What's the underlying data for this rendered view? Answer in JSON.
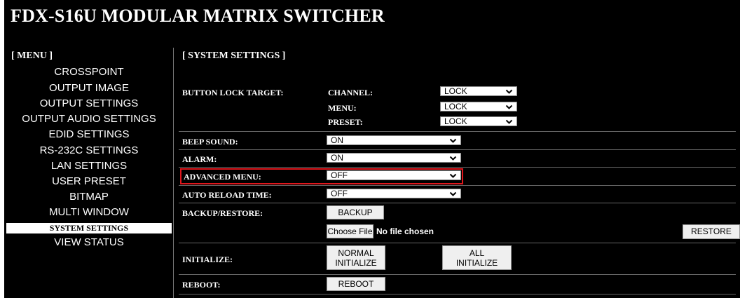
{
  "header": {
    "title": "FDX-S16U MODULAR MATRIX SWITCHER"
  },
  "menu": {
    "header": "[ MENU ]",
    "items": [
      {
        "label": "CROSSPOINT",
        "active": false
      },
      {
        "label": "OUTPUT IMAGE",
        "active": false
      },
      {
        "label": "OUTPUT SETTINGS",
        "active": false
      },
      {
        "label": "OUTPUT AUDIO SETTINGS",
        "active": false
      },
      {
        "label": "EDID SETTINGS",
        "active": false
      },
      {
        "label": "RS-232C SETTINGS",
        "active": false
      },
      {
        "label": "LAN SETTINGS",
        "active": false
      },
      {
        "label": "USER PRESET",
        "active": false
      },
      {
        "label": "BITMAP",
        "active": false
      },
      {
        "label": "MULTI WINDOW",
        "active": false
      },
      {
        "label": "SYSTEM SETTINGS",
        "active": true
      },
      {
        "label": "VIEW STATUS",
        "active": false
      }
    ]
  },
  "main": {
    "section_title": "[ SYSTEM SETTINGS ]",
    "button_lock": {
      "label": "BUTTON LOCK TARGET:",
      "channel": {
        "label": "CHANNEL:",
        "value": "LOCK"
      },
      "menu": {
        "label": "MENU:",
        "value": "LOCK"
      },
      "preset": {
        "label": "PRESET:",
        "value": "LOCK"
      }
    },
    "beep_sound": {
      "label": "BEEP SOUND:",
      "value": "ON"
    },
    "alarm": {
      "label": "ALARM:",
      "value": "ON"
    },
    "advanced_menu": {
      "label": "ADVANCED MENU:",
      "value": "OFF"
    },
    "auto_reload": {
      "label": "AUTO RELOAD TIME:",
      "value": "OFF"
    },
    "backup_restore": {
      "label": "BACKUP/RESTORE:",
      "backup_button": "BACKUP",
      "choose_file_button": "Choose File",
      "no_file_text": "No file chosen",
      "restore_button": "RESTORE"
    },
    "initialize": {
      "label": "INITIALIZE:",
      "normal_line1": "NORMAL",
      "normal_line2": "INITIALIZE",
      "all_line1": "ALL",
      "all_line2": "INITIALIZE"
    },
    "reboot": {
      "label": "REBOOT:",
      "button": "REBOOT"
    }
  },
  "colors": {
    "background": "#000000",
    "text": "#ffffff",
    "highlight_border": "#e0161c"
  }
}
